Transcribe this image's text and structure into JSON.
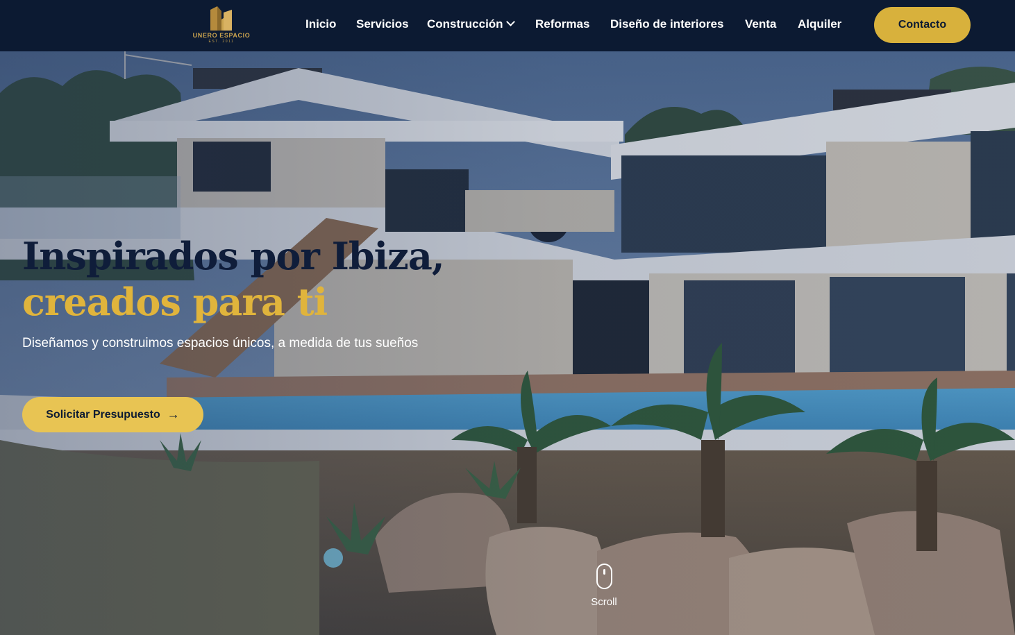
{
  "brand": {
    "name": "UNERO ESPACIO",
    "est": "EST. 2011",
    "logo_icon": "house-outline-logo",
    "accent": "#d8b13c",
    "header_bg": "#0c1a32"
  },
  "nav": {
    "items": [
      {
        "label": "Inicio"
      },
      {
        "label": "Servicios"
      },
      {
        "label": "Construcción",
        "icon": "chevron-down-icon"
      },
      {
        "label": "Reformas"
      },
      {
        "label": "Diseño de interiores"
      },
      {
        "label": "Venta"
      },
      {
        "label": "Alquiler"
      }
    ],
    "contact_label": "Contacto"
  },
  "hero": {
    "title_line1": "Inspirados por Ibiza,",
    "title_line2": "creados para ti",
    "subtitle": "Diseñamos y construimos espacios únicos, a medida de tus sueños",
    "cta_label": "Solicitar Presupuesto",
    "cta_icon": "arrow-right-icon",
    "scroll_label": "Scroll",
    "scroll_icon": "mouse-icon",
    "title_color": "#0f1d3a",
    "highlight_color": "#e0b43c"
  }
}
